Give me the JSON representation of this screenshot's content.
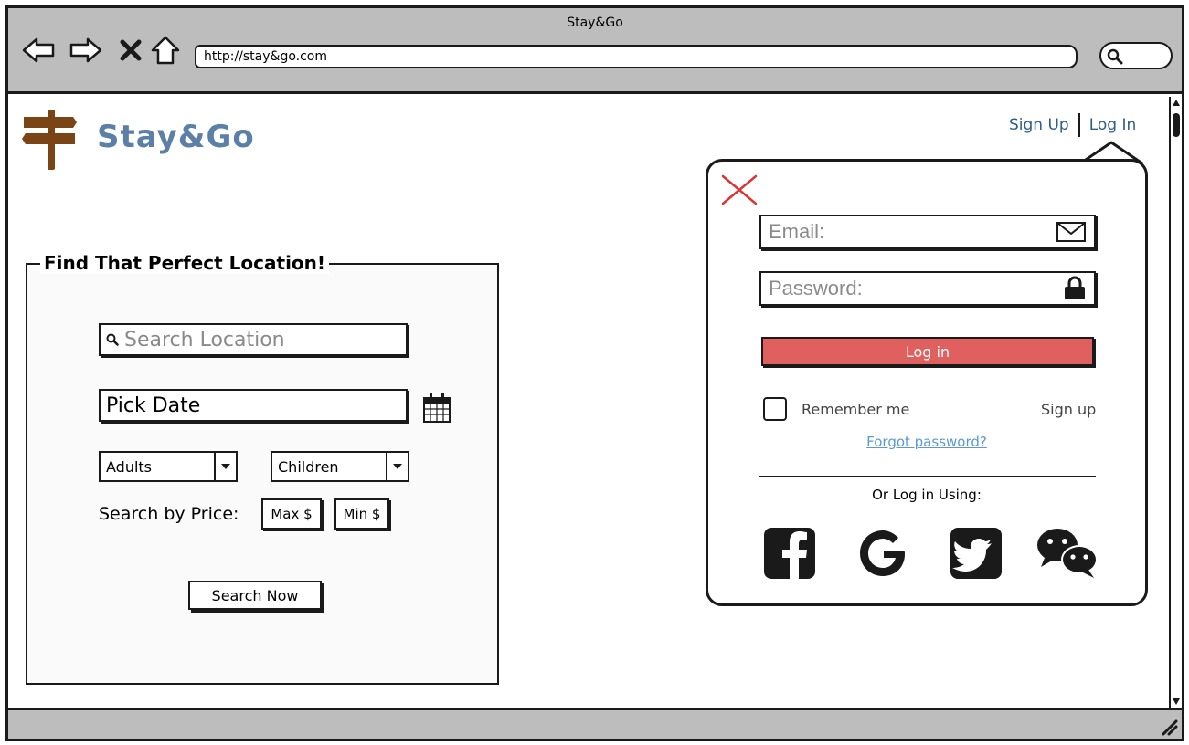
{
  "window": {
    "title": "Stay&Go"
  },
  "browser": {
    "url": "http://stay&go.com",
    "nav_icons": [
      "back-arrow-icon",
      "forward-arrow-icon",
      "stop-icon",
      "home-icon"
    ]
  },
  "header": {
    "brand": "Stay&Go",
    "sign_up": "Sign Up",
    "log_in": "Log In",
    "brand_color": "#5b7fa6",
    "logo_color": "#7a4414"
  },
  "search_panel": {
    "title": "Find That Perfect Location!",
    "location_placeholder": "Search Location",
    "date_value": "Pick Date",
    "adults_label": "Adults",
    "children_label": "Children",
    "price_label": "Search by Price:",
    "max_label": "Max $",
    "min_label": "Min $",
    "search_button": "Search Now"
  },
  "login_popover": {
    "email_placeholder": "Email:",
    "password_placeholder": "Password:",
    "login_button": "Log in",
    "login_button_color": "#e06060",
    "remember_me": "Remember me",
    "sign_up": "Sign up",
    "forgot_password": "Forgot password?",
    "or_login_using": "Or Log in Using:",
    "social_icons": [
      "facebook-icon",
      "google-icon",
      "twitter-icon",
      "wechat-icon"
    ]
  }
}
